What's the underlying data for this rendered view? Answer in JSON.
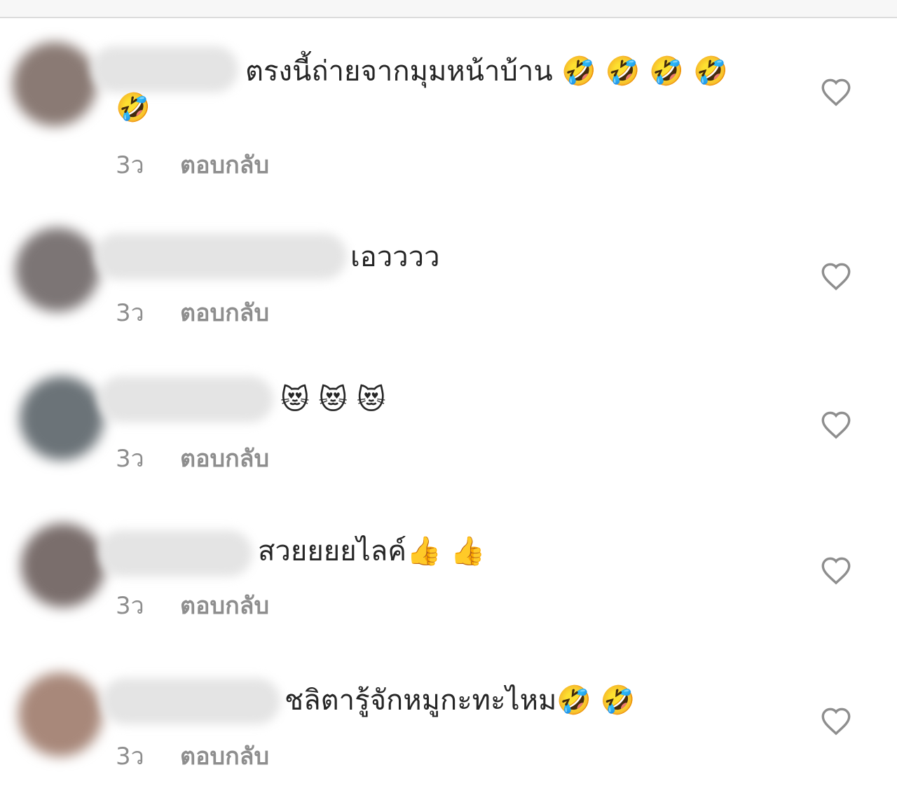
{
  "comments": [
    {
      "text": "ตรงนี้ถ่ายจากมุมหน้าบ้าน",
      "emoji_line1": "🤣 🤣 🤣 🤣",
      "emoji_line2": "🤣",
      "time": "3ว",
      "reply_label": "ตอบกลับ",
      "avatar_color": "#8a7a74"
    },
    {
      "text": "เอวววว",
      "time": "3ว",
      "reply_label": "ตอบกลับ",
      "avatar_color": "#7c7575"
    },
    {
      "text": "",
      "emoji": "😻 😻 😻",
      "time": "3ว",
      "reply_label": "ตอบกลับ",
      "avatar_color": "#6b7378"
    },
    {
      "text": "สวยยยยไลค์",
      "emoji": "👍 👍",
      "time": "3ว",
      "reply_label": "ตอบกลับ",
      "avatar_color": "#7a6e6c"
    },
    {
      "text": "ชลิตารู้จักหมูกะทะไหม",
      "emoji": "🤣 🤣",
      "time": "3ว",
      "reply_label": "ตอบกลับ",
      "avatar_color": "#a8887a"
    }
  ],
  "icons": {
    "like": "heart-outline-icon"
  }
}
